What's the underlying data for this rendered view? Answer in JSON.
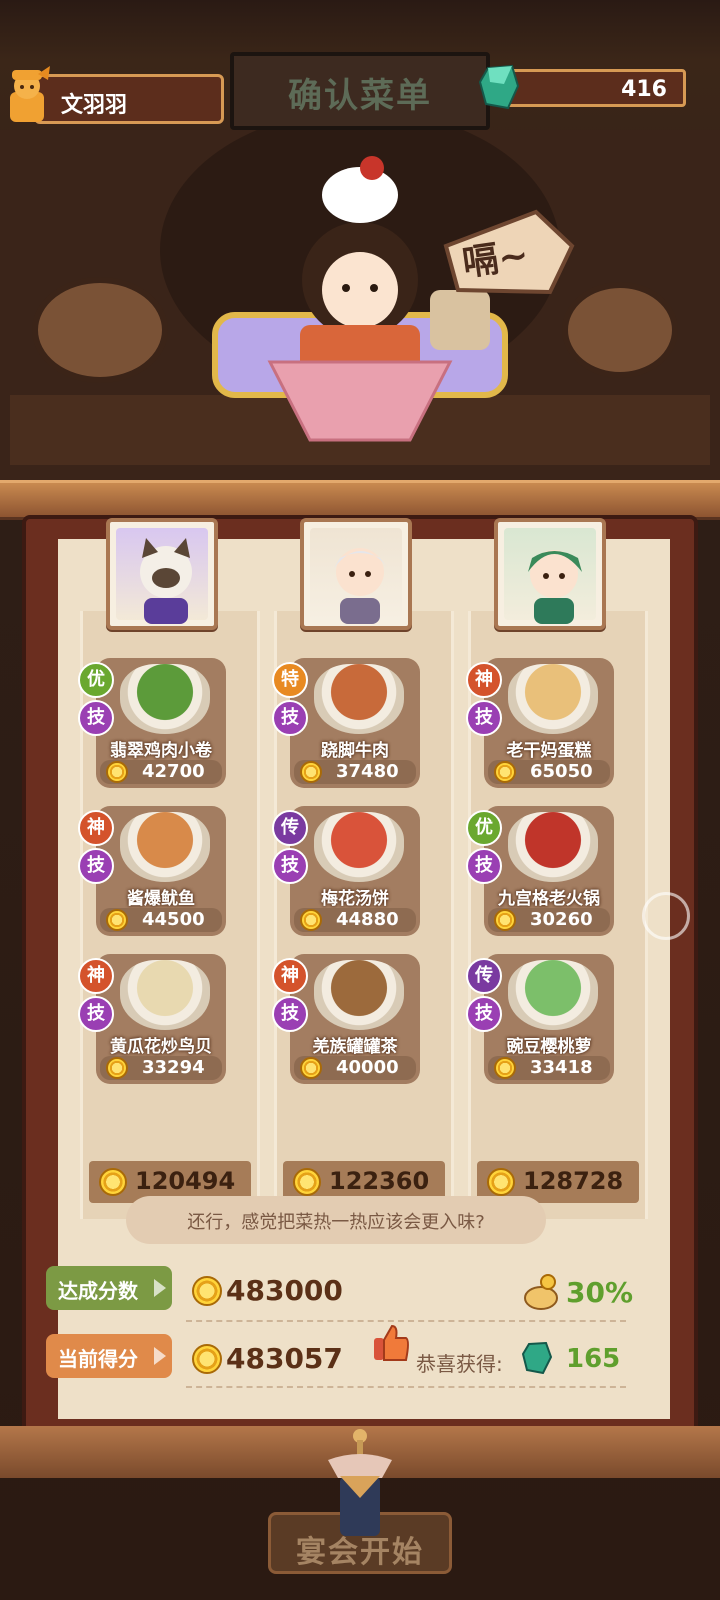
{
  "header": {
    "player_name": "文羽羽",
    "title": "确认菜单",
    "gem_count": "416"
  },
  "speech_bubble": "嗝~",
  "guests": [
    {
      "total": "120494",
      "dishes": [
        {
          "quality": "优",
          "quality_color": "#6aa82f",
          "skill": "技",
          "name": "翡翠鸡肉小卷",
          "price": "42700",
          "food_color": "#5c9b3a"
        },
        {
          "quality": "神",
          "quality_color": "#d4532c",
          "skill": "技",
          "name": "酱爆鱿鱼",
          "price": "44500",
          "food_color": "#d88a4a"
        },
        {
          "quality": "神",
          "quality_color": "#d4532c",
          "skill": "技",
          "name": "黄瓜花炒鸟贝",
          "price": "33294",
          "food_color": "#e8d9b0"
        }
      ]
    },
    {
      "total": "122360",
      "dishes": [
        {
          "quality": "特",
          "quality_color": "#e88a22",
          "skill": "技",
          "name": "跷脚牛肉",
          "price": "37480",
          "food_color": "#c86a3a"
        },
        {
          "quality": "传",
          "quality_color": "#7a3aa0",
          "skill": "技",
          "name": "梅花汤饼",
          "price": "44880",
          "food_color": "#d9533a"
        },
        {
          "quality": "神",
          "quality_color": "#d4532c",
          "skill": "技",
          "name": "羌族罐罐茶",
          "price": "40000",
          "food_color": "#9c6a3c"
        }
      ]
    },
    {
      "total": "128728",
      "dishes": [
        {
          "quality": "神",
          "quality_color": "#d4532c",
          "skill": "技",
          "name": "老干妈蛋糕",
          "price": "65050",
          "food_color": "#e9c07a"
        },
        {
          "quality": "优",
          "quality_color": "#6aa82f",
          "skill": "技",
          "name": "九宫格老火锅",
          "price": "30260",
          "food_color": "#c0352a"
        },
        {
          "quality": "传",
          "quality_color": "#7a3aa0",
          "skill": "技",
          "name": "豌豆樱桃萝",
          "price": "33418",
          "food_color": "#7cbf6a"
        }
      ]
    }
  ],
  "comment": "还行，感觉把菜热一热应该会更入味?",
  "target": {
    "label": "达成分数",
    "value": "483000",
    "bonus": "30%"
  },
  "current": {
    "label": "当前得分",
    "value": "483057",
    "reward_label": "恭喜获得:",
    "reward_value": "165"
  },
  "start_button": "宴会开始",
  "colors": {
    "accent_green": "#5f9f2d",
    "gem": "#3fbf9a",
    "coin": "#e5a118"
  }
}
